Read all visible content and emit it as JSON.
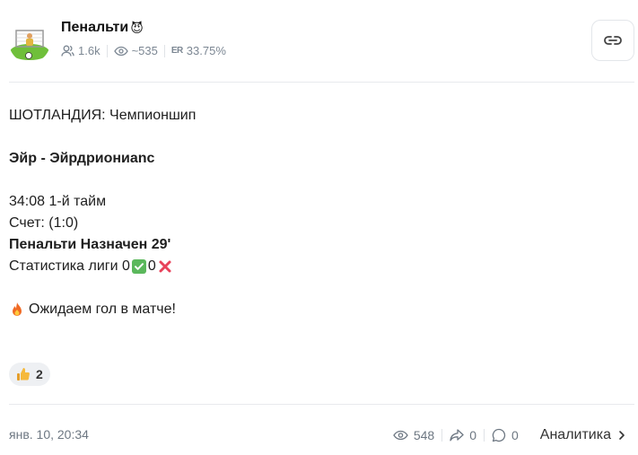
{
  "channel": {
    "name": "Пенальти",
    "name_emoji": "😈",
    "subscribers": "1.6k",
    "views_avg": "~535",
    "er_label": "ER",
    "er_value": "33.75%"
  },
  "post": {
    "lines": {
      "l1": "ШОТЛАНДИЯ: Чемпионшип",
      "l2": "Эйр - Эйрдриониаnс",
      "l3": "34:08 1-й тайм",
      "l4": "Счет: (1:0)",
      "l5": "Пенальти Назначен 29'",
      "l6_prefix": "Статистика лиги 0",
      "l6_mid": "0",
      "l7": "Ожидаем гол в матче!"
    },
    "reaction": {
      "emoji": "👍",
      "count": "2"
    }
  },
  "footer": {
    "date": "янв. 10, 20:34",
    "views": "548",
    "shares": "0",
    "comments": "0",
    "analytics_label": "Аналитика"
  },
  "colors": {
    "muted": "#7c8793",
    "divider": "#e8eaed",
    "check_green": "#5bb85c",
    "cross_red": "#e8425a",
    "fire": "#f06a24"
  },
  "icons": [
    "link-icon",
    "subscribers-icon",
    "eye-icon",
    "share-icon",
    "comment-icon",
    "chevron-right-icon",
    "check-icon",
    "cross-icon",
    "fire-icon",
    "thumbs-up-icon"
  ]
}
